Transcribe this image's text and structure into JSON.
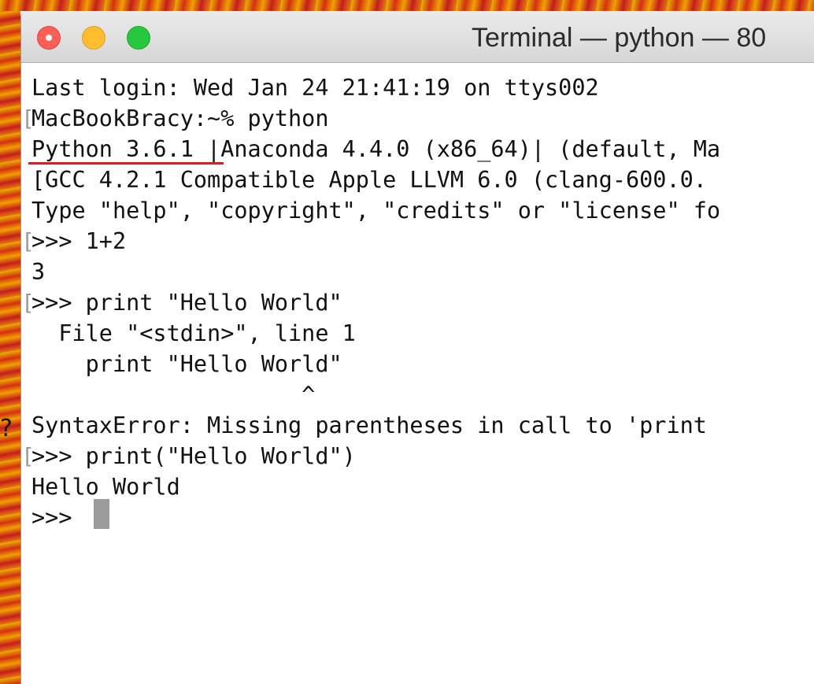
{
  "window": {
    "title": "Terminal — python — 80"
  },
  "colors": {
    "close": "#fd5f57",
    "minimize": "#febc2e",
    "zoom": "#27c840",
    "annotation_underline": "#d81e1e",
    "cursor": "#9b9b9b"
  },
  "wallpaper_mark": "?",
  "terminal": {
    "lines": [
      "Last login: Wed Jan 24 21:41:19 on ttys002",
      "MacBookBracy:~% python",
      "Python 3.6.1 |Anaconda 4.4.0 (x86_64)| (default, Ma",
      "[GCC 4.2.1 Compatible Apple LLVM 6.0 (clang-600.0.",
      "Type \"help\", \"copyright\", \"credits\" or \"license\" fo",
      ">>> 1+2",
      "3",
      ">>> print \"Hello World\"",
      "  File \"<stdin>\", line 1",
      "    print \"Hello World\"",
      "                    ^",
      "SyntaxError: Missing parentheses in call to 'print",
      ">>> print(\"Hello World\")",
      "Hello World",
      ">>> "
    ],
    "bracket_glyph": "["
  }
}
